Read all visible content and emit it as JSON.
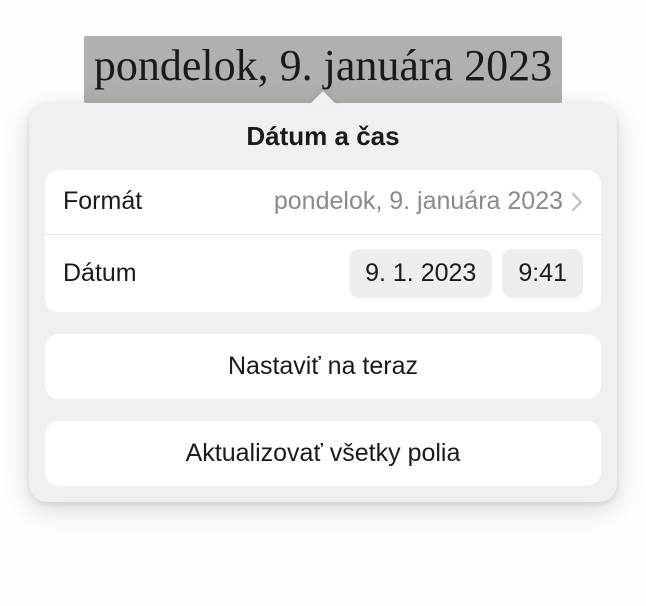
{
  "selected_text": "pondelok, 9. januára 2023",
  "popover": {
    "title": "Dátum a čas",
    "format": {
      "label": "Formát",
      "value": "pondelok, 9. januára 2023"
    },
    "date": {
      "label": "Dátum",
      "date_value": "9. 1. 2023",
      "time_value": "9:41"
    },
    "set_now_label": "Nastaviť na teraz",
    "update_all_label": "Aktualizovať všetky polia"
  }
}
